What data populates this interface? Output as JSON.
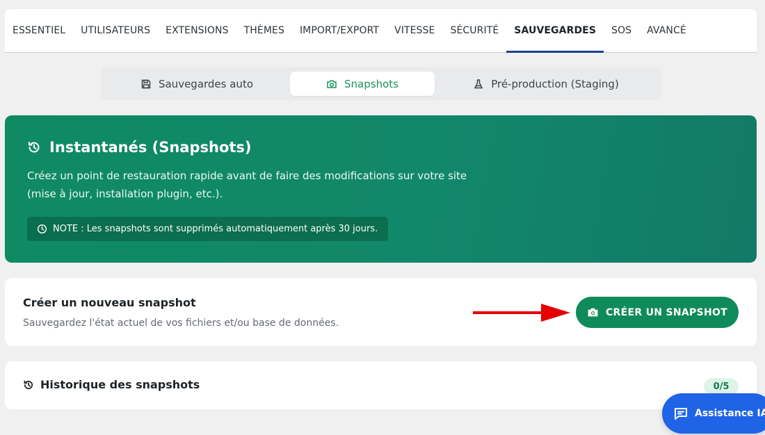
{
  "nav": {
    "tabs": [
      {
        "label": "ESSENTIEL"
      },
      {
        "label": "UTILISATEURS"
      },
      {
        "label": "EXTENSIONS"
      },
      {
        "label": "THÈMES"
      },
      {
        "label": "IMPORT/EXPORT"
      },
      {
        "label": "VITESSE"
      },
      {
        "label": "SÉCURITÉ"
      },
      {
        "label": "SAUVEGARDES",
        "active": true
      },
      {
        "label": "SOS"
      },
      {
        "label": "AVANCÉ"
      }
    ]
  },
  "subtabs": [
    {
      "label": "Sauvegardes auto",
      "icon": "save-icon"
    },
    {
      "label": "Snapshots",
      "icon": "camera-icon",
      "active": true
    },
    {
      "label": "Pré-production (Staging)",
      "icon": "flask-icon"
    }
  ],
  "hero": {
    "title": "Instantanés (Snapshots)",
    "description": "Créez un point de restauration rapide avant de faire des modifications sur votre site (mise à jour, installation plugin, etc.).",
    "note": "NOTE : Les snapshots sont supprimés automatiquement après 30 jours."
  },
  "create": {
    "title": "Créer un nouveau snapshot",
    "subtitle": "Sauvegardez l'état actuel de vos fichiers et/ou base de données.",
    "button_label": "CRÉER UN SNAPSHOT"
  },
  "history": {
    "title": "Historique des snapshots",
    "count": "0/5"
  },
  "assistant": {
    "label": "Assistance IA"
  },
  "colors": {
    "accent_green": "#0f8a5a",
    "nav_active": "#1f3f8f",
    "assistant_blue": "#1f63e6",
    "arrow_red": "#e60000"
  }
}
